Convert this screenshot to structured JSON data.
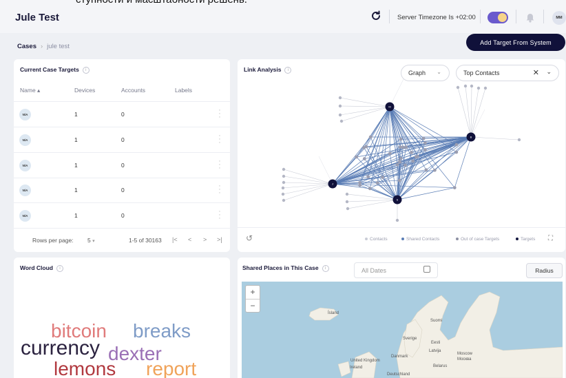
{
  "top_cut_text": "ступности и масштабности решень.",
  "app": {
    "title": "Jule Test"
  },
  "header": {
    "timezone": "Server Timezone Is +02:00",
    "avatar_initials": "MM"
  },
  "breadcrumb": {
    "root": "Cases",
    "separator": "›",
    "current": "jule test"
  },
  "actions": {
    "add_target": "Add Target From System"
  },
  "targets": {
    "title": "Current Case Targets",
    "columns": [
      "Name ▴",
      "Devices",
      "Accounts",
      "Labels"
    ],
    "rows": [
      {
        "name": "N/A",
        "devices": "1",
        "accounts": "0",
        "labels": ""
      },
      {
        "name": "N/A",
        "devices": "1",
        "accounts": "0",
        "labels": ""
      },
      {
        "name": "N/A",
        "devices": "1",
        "accounts": "0",
        "labels": ""
      },
      {
        "name": "N/A",
        "devices": "1",
        "accounts": "0",
        "labels": ""
      },
      {
        "name": "N/A",
        "devices": "1",
        "accounts": "0",
        "labels": ""
      }
    ],
    "rows_per_page_label": "Rows per page:",
    "rows_per_page_value": "5",
    "range": "1-5 of 30163"
  },
  "link_analysis": {
    "title": "Link Analysis",
    "view_select": "Graph",
    "filter_select": "Top Contacts",
    "legend": [
      "Contacts",
      "Shared Contacts",
      "Out of case Targets",
      "Targets"
    ],
    "legend_colors": [
      "#c9ccd6",
      "#5a7db5",
      "#8d90a3",
      "#14163f"
    ],
    "node_labels": [
      "M",
      "B",
      "J",
      "S"
    ]
  },
  "word_cloud": {
    "title": "Word Cloud",
    "words": [
      {
        "text": "bitcoin",
        "color": "#e07b7b"
      },
      {
        "text": "breaks",
        "color": "#7f9cc7"
      },
      {
        "text": "currency",
        "color": "#2c2340"
      },
      {
        "text": "dexter",
        "color": "#9a6fb5"
      },
      {
        "text": "lemons",
        "color": "#b1393f"
      },
      {
        "text": "report",
        "color": "#f0a35a"
      }
    ]
  },
  "places": {
    "title": "Shared Places in This Case",
    "dates_placeholder": "All Dates",
    "radius_button": "Radius",
    "map_labels": [
      "Ísland",
      "Suomi",
      "Sverige",
      "Eesti",
      "Latvija",
      "Danmark",
      "United Kingdom",
      "Ireland",
      "Moscow\nМосква",
      "Belarus",
      "Deutschland"
    ]
  }
}
